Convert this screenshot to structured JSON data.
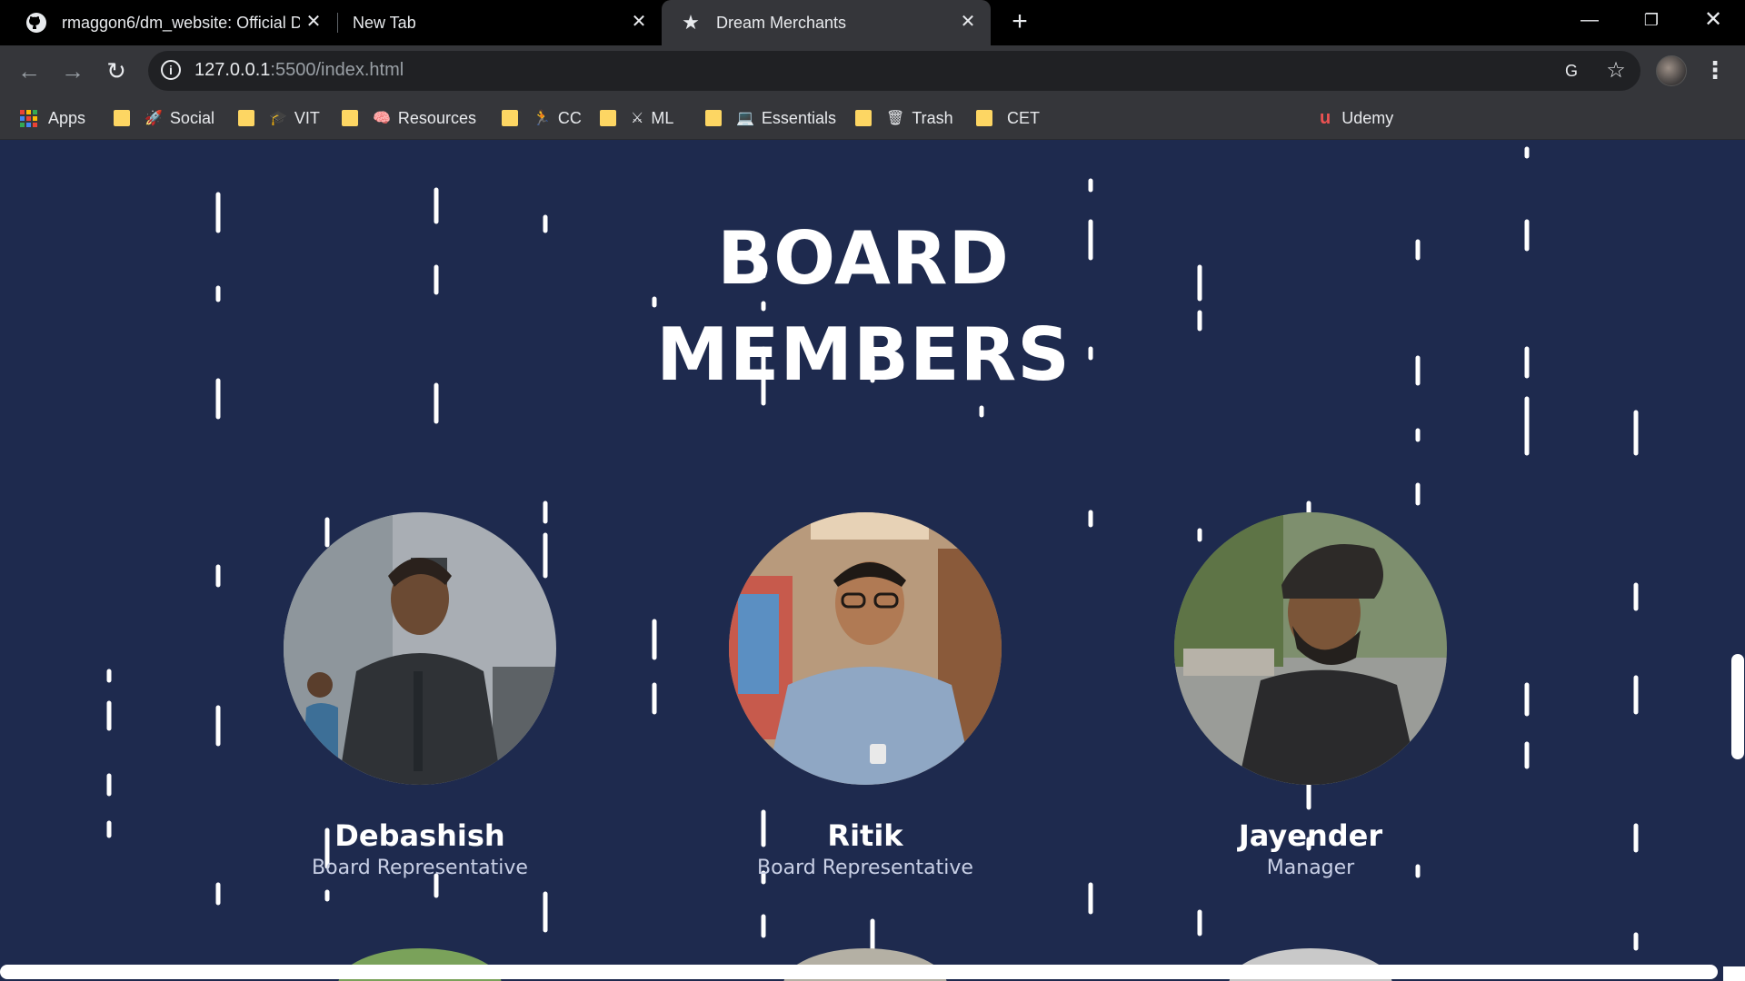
{
  "browser": {
    "tabs": [
      {
        "title": "rmaggon6/dm_website: Official D",
        "icon": "github-icon"
      },
      {
        "title": "New Tab",
        "icon": ""
      },
      {
        "title": "Dream Merchants",
        "icon": "star-icon",
        "active": true
      }
    ],
    "address": {
      "host": "127.0.0.1",
      "path": ":5500/index.html"
    },
    "bookmarks": [
      "Apps",
      "Social",
      "VIT",
      "Resources",
      "CC",
      "ML",
      "Essentials",
      "Trash",
      "CET",
      "Udemy"
    ]
  },
  "page": {
    "heading_line1": "BOARD",
    "heading_line2": "MEMBERS",
    "members": [
      {
        "name": "Debashish",
        "role": "Board Representative"
      },
      {
        "name": "Ritik",
        "role": "Board Representative"
      },
      {
        "name": "Jayender",
        "role": "Manager"
      }
    ]
  },
  "colors": {
    "page_background": "#1e2a4e",
    "rain_streak": "#ffffff",
    "text": "#ffffff",
    "chrome_tabbar": "#000000",
    "chrome_toolbar": "#35363a"
  }
}
